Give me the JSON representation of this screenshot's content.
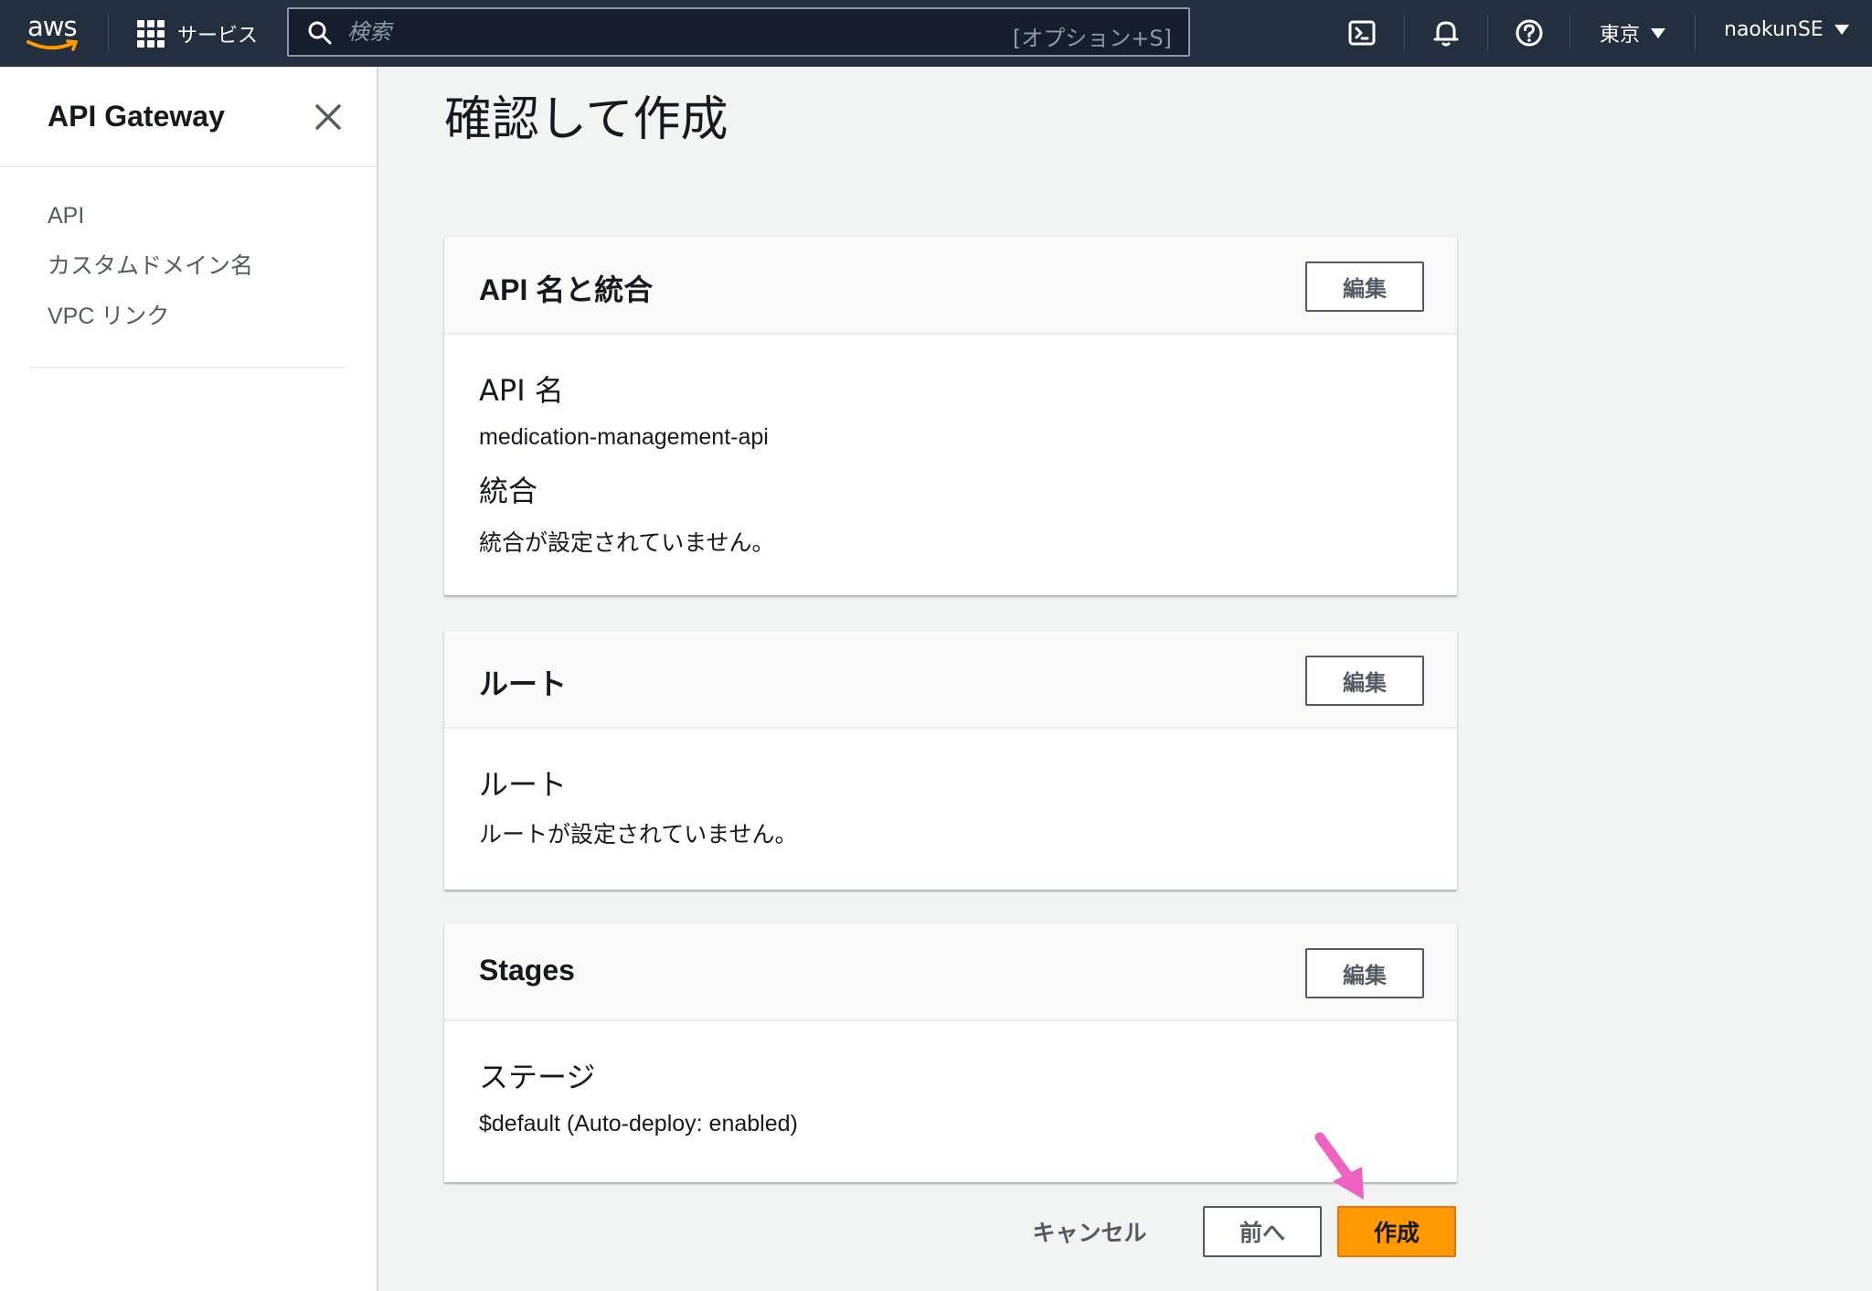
{
  "topbar": {
    "logo_text": "aws",
    "services_label": "サービス",
    "search_placeholder": "検索",
    "search_shortcut": "[オプション+S]",
    "icons": [
      "cloudshell-icon",
      "bell-icon",
      "help-icon"
    ],
    "region": "東京",
    "user": "naokunSE"
  },
  "sidebar": {
    "title": "API Gateway",
    "items": [
      {
        "label": "API"
      },
      {
        "label": "カスタムドメイン名"
      },
      {
        "label": "VPC リンク"
      }
    ]
  },
  "main": {
    "page_title": "確認して作成",
    "sections": [
      {
        "title": "API 名と統合",
        "edit_label": "編集",
        "fields": [
          {
            "label": "API 名",
            "value": "medication-management-api"
          },
          {
            "label": "統合",
            "value": "統合が設定されていません。"
          }
        ]
      },
      {
        "title": "ルート",
        "edit_label": "編集",
        "fields": [
          {
            "label": "ルート",
            "value": "ルートが設定されていません。"
          }
        ]
      },
      {
        "title": "Stages",
        "edit_label": "編集",
        "fields": [
          {
            "label": "ステージ",
            "value": "$default (Auto-deploy: enabled)"
          }
        ]
      }
    ],
    "footer": {
      "cancel_label": "キャンセル",
      "prev_label": "前へ",
      "create_label": "作成"
    }
  },
  "colors": {
    "topbar_bg": "#232f3e",
    "primary_button": "#ff9900",
    "annotation_arrow": "#f062c0"
  }
}
